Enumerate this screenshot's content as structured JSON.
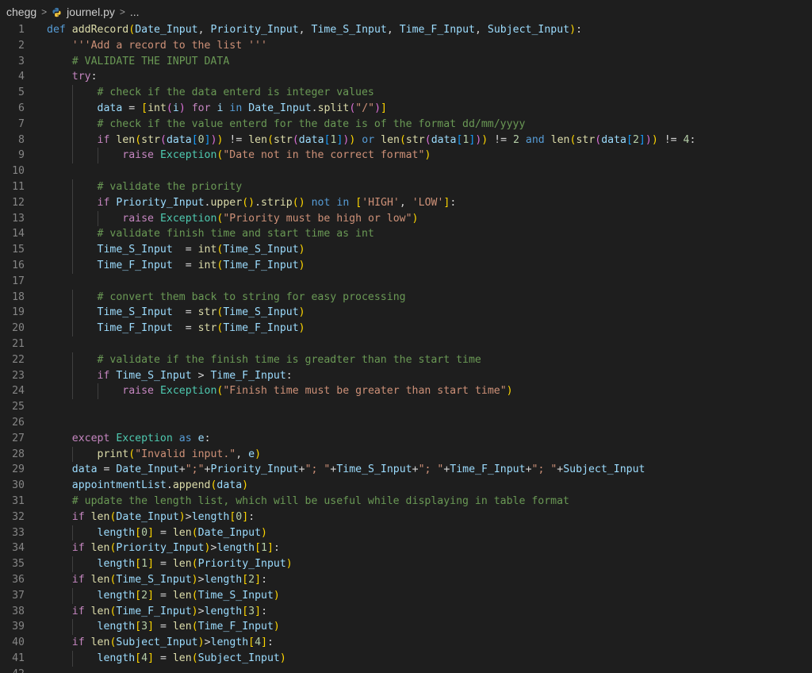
{
  "breadcrumb": {
    "folder": "chegg",
    "file": "journel.py",
    "ellipsis": "...",
    "separator": ">",
    "file_icon": "python-icon"
  },
  "editor": {
    "lines": [
      {
        "n": "1",
        "t": "def addRecord(Date_Input, Priority_Input, Time_S_Input, Time_F_Input, Subject_Input):"
      },
      {
        "n": "2",
        "t": "    '''Add a record to the list '''"
      },
      {
        "n": "3",
        "t": "    # VALIDATE THE INPUT DATA"
      },
      {
        "n": "4",
        "t": "    try:"
      },
      {
        "n": "5",
        "t": "        # check if the data enterd is integer values"
      },
      {
        "n": "6",
        "t": "        data = [int(i) for i in Date_Input.split(\"/\")]"
      },
      {
        "n": "7",
        "t": "        # check if the value enterd for the date is of the format dd/mm/yyyy"
      },
      {
        "n": "8",
        "t": "        if len(str(data[0])) != len(str(data[1])) or len(str(data[1])) != 2 and len(str(data[2])) != 4:"
      },
      {
        "n": "9",
        "t": "            raise Exception(\"Date not in the correct format\")"
      },
      {
        "n": "10",
        "t": ""
      },
      {
        "n": "11",
        "t": "        # validate the priority"
      },
      {
        "n": "12",
        "t": "        if Priority_Input.upper().strip() not in ['HIGH', 'LOW']:"
      },
      {
        "n": "13",
        "t": "            raise Exception(\"Priority must be high or low\")"
      },
      {
        "n": "14",
        "t": "        # validate finish time and start time as int"
      },
      {
        "n": "15",
        "t": "        Time_S_Input  = int(Time_S_Input)"
      },
      {
        "n": "16",
        "t": "        Time_F_Input  = int(Time_F_Input)"
      },
      {
        "n": "17",
        "t": ""
      },
      {
        "n": "18",
        "t": "        # convert them back to string for easy processing"
      },
      {
        "n": "19",
        "t": "        Time_S_Input  = str(Time_S_Input)"
      },
      {
        "n": "20",
        "t": "        Time_F_Input  = str(Time_F_Input)"
      },
      {
        "n": "21",
        "t": ""
      },
      {
        "n": "22",
        "t": "        # validate if the finish time is greadter than the start time"
      },
      {
        "n": "23",
        "t": "        if Time_S_Input > Time_F_Input:"
      },
      {
        "n": "24",
        "t": "            raise Exception(\"Finish time must be greater than start time\")"
      },
      {
        "n": "25",
        "t": ""
      },
      {
        "n": "26",
        "t": ""
      },
      {
        "n": "27",
        "t": "    except Exception as e:"
      },
      {
        "n": "28",
        "t": "        print(\"Invalid input.\", e)"
      },
      {
        "n": "29",
        "t": "    data = Date_Input+\";\"+Priority_Input+\"; \"+Time_S_Input+\"; \"+Time_F_Input+\"; \"+Subject_Input"
      },
      {
        "n": "30",
        "t": "    appointmentList.append(data)"
      },
      {
        "n": "31",
        "t": "    # update the length list, which will be useful while displaying in table format"
      },
      {
        "n": "32",
        "t": "    if len(Date_Input)>length[0]:"
      },
      {
        "n": "33",
        "t": "        length[0] = len(Date_Input)"
      },
      {
        "n": "34",
        "t": "    if len(Priority_Input)>length[1]:"
      },
      {
        "n": "35",
        "t": "        length[1] = len(Priority_Input)"
      },
      {
        "n": "36",
        "t": "    if len(Time_S_Input)>length[2]:"
      },
      {
        "n": "37",
        "t": "        length[2] = len(Time_S_Input)"
      },
      {
        "n": "38",
        "t": "    if len(Time_F_Input)>length[3]:"
      },
      {
        "n": "39",
        "t": "        length[3] = len(Time_F_Input)"
      },
      {
        "n": "40",
        "t": "    if len(Subject_Input)>length[4]:"
      },
      {
        "n": "41",
        "t": "        length[4] = len(Subject_Input)"
      },
      {
        "n": "42",
        "t": ""
      }
    ]
  },
  "colors": {
    "background": "#1e1e1e",
    "keyword": "#569cd6",
    "control_keyword": "#c586c0",
    "function": "#dcdcaa",
    "string": "#ce9178",
    "comment": "#6a9955",
    "number": "#b5cea8",
    "line_number": "#858585"
  }
}
